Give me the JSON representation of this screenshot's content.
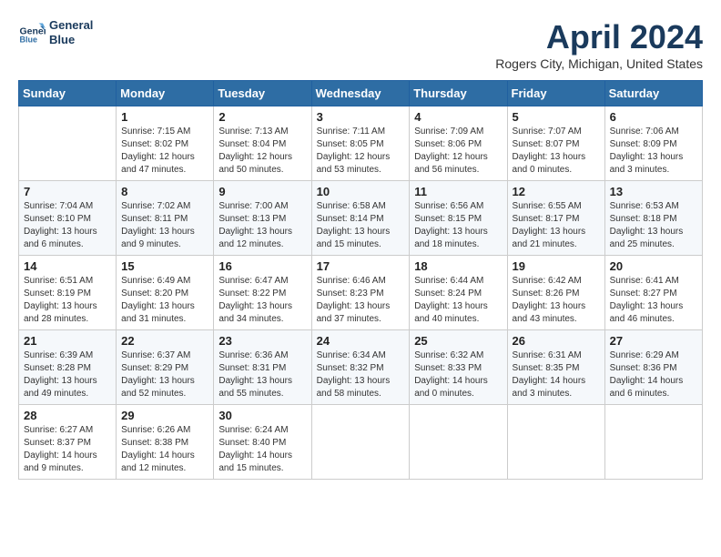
{
  "header": {
    "logo_line1": "General",
    "logo_line2": "Blue",
    "month_title": "April 2024",
    "location": "Rogers City, Michigan, United States"
  },
  "weekdays": [
    "Sunday",
    "Monday",
    "Tuesday",
    "Wednesday",
    "Thursday",
    "Friday",
    "Saturday"
  ],
  "weeks": [
    [
      {
        "day": "",
        "sunrise": "",
        "sunset": "",
        "daylight": ""
      },
      {
        "day": "1",
        "sunrise": "Sunrise: 7:15 AM",
        "sunset": "Sunset: 8:02 PM",
        "daylight": "Daylight: 12 hours and 47 minutes."
      },
      {
        "day": "2",
        "sunrise": "Sunrise: 7:13 AM",
        "sunset": "Sunset: 8:04 PM",
        "daylight": "Daylight: 12 hours and 50 minutes."
      },
      {
        "day": "3",
        "sunrise": "Sunrise: 7:11 AM",
        "sunset": "Sunset: 8:05 PM",
        "daylight": "Daylight: 12 hours and 53 minutes."
      },
      {
        "day": "4",
        "sunrise": "Sunrise: 7:09 AM",
        "sunset": "Sunset: 8:06 PM",
        "daylight": "Daylight: 12 hours and 56 minutes."
      },
      {
        "day": "5",
        "sunrise": "Sunrise: 7:07 AM",
        "sunset": "Sunset: 8:07 PM",
        "daylight": "Daylight: 13 hours and 0 minutes."
      },
      {
        "day": "6",
        "sunrise": "Sunrise: 7:06 AM",
        "sunset": "Sunset: 8:09 PM",
        "daylight": "Daylight: 13 hours and 3 minutes."
      }
    ],
    [
      {
        "day": "7",
        "sunrise": "Sunrise: 7:04 AM",
        "sunset": "Sunset: 8:10 PM",
        "daylight": "Daylight: 13 hours and 6 minutes."
      },
      {
        "day": "8",
        "sunrise": "Sunrise: 7:02 AM",
        "sunset": "Sunset: 8:11 PM",
        "daylight": "Daylight: 13 hours and 9 minutes."
      },
      {
        "day": "9",
        "sunrise": "Sunrise: 7:00 AM",
        "sunset": "Sunset: 8:13 PM",
        "daylight": "Daylight: 13 hours and 12 minutes."
      },
      {
        "day": "10",
        "sunrise": "Sunrise: 6:58 AM",
        "sunset": "Sunset: 8:14 PM",
        "daylight": "Daylight: 13 hours and 15 minutes."
      },
      {
        "day": "11",
        "sunrise": "Sunrise: 6:56 AM",
        "sunset": "Sunset: 8:15 PM",
        "daylight": "Daylight: 13 hours and 18 minutes."
      },
      {
        "day": "12",
        "sunrise": "Sunrise: 6:55 AM",
        "sunset": "Sunset: 8:17 PM",
        "daylight": "Daylight: 13 hours and 21 minutes."
      },
      {
        "day": "13",
        "sunrise": "Sunrise: 6:53 AM",
        "sunset": "Sunset: 8:18 PM",
        "daylight": "Daylight: 13 hours and 25 minutes."
      }
    ],
    [
      {
        "day": "14",
        "sunrise": "Sunrise: 6:51 AM",
        "sunset": "Sunset: 8:19 PM",
        "daylight": "Daylight: 13 hours and 28 minutes."
      },
      {
        "day": "15",
        "sunrise": "Sunrise: 6:49 AM",
        "sunset": "Sunset: 8:20 PM",
        "daylight": "Daylight: 13 hours and 31 minutes."
      },
      {
        "day": "16",
        "sunrise": "Sunrise: 6:47 AM",
        "sunset": "Sunset: 8:22 PM",
        "daylight": "Daylight: 13 hours and 34 minutes."
      },
      {
        "day": "17",
        "sunrise": "Sunrise: 6:46 AM",
        "sunset": "Sunset: 8:23 PM",
        "daylight": "Daylight: 13 hours and 37 minutes."
      },
      {
        "day": "18",
        "sunrise": "Sunrise: 6:44 AM",
        "sunset": "Sunset: 8:24 PM",
        "daylight": "Daylight: 13 hours and 40 minutes."
      },
      {
        "day": "19",
        "sunrise": "Sunrise: 6:42 AM",
        "sunset": "Sunset: 8:26 PM",
        "daylight": "Daylight: 13 hours and 43 minutes."
      },
      {
        "day": "20",
        "sunrise": "Sunrise: 6:41 AM",
        "sunset": "Sunset: 8:27 PM",
        "daylight": "Daylight: 13 hours and 46 minutes."
      }
    ],
    [
      {
        "day": "21",
        "sunrise": "Sunrise: 6:39 AM",
        "sunset": "Sunset: 8:28 PM",
        "daylight": "Daylight: 13 hours and 49 minutes."
      },
      {
        "day": "22",
        "sunrise": "Sunrise: 6:37 AM",
        "sunset": "Sunset: 8:29 PM",
        "daylight": "Daylight: 13 hours and 52 minutes."
      },
      {
        "day": "23",
        "sunrise": "Sunrise: 6:36 AM",
        "sunset": "Sunset: 8:31 PM",
        "daylight": "Daylight: 13 hours and 55 minutes."
      },
      {
        "day": "24",
        "sunrise": "Sunrise: 6:34 AM",
        "sunset": "Sunset: 8:32 PM",
        "daylight": "Daylight: 13 hours and 58 minutes."
      },
      {
        "day": "25",
        "sunrise": "Sunrise: 6:32 AM",
        "sunset": "Sunset: 8:33 PM",
        "daylight": "Daylight: 14 hours and 0 minutes."
      },
      {
        "day": "26",
        "sunrise": "Sunrise: 6:31 AM",
        "sunset": "Sunset: 8:35 PM",
        "daylight": "Daylight: 14 hours and 3 minutes."
      },
      {
        "day": "27",
        "sunrise": "Sunrise: 6:29 AM",
        "sunset": "Sunset: 8:36 PM",
        "daylight": "Daylight: 14 hours and 6 minutes."
      }
    ],
    [
      {
        "day": "28",
        "sunrise": "Sunrise: 6:27 AM",
        "sunset": "Sunset: 8:37 PM",
        "daylight": "Daylight: 14 hours and 9 minutes."
      },
      {
        "day": "29",
        "sunrise": "Sunrise: 6:26 AM",
        "sunset": "Sunset: 8:38 PM",
        "daylight": "Daylight: 14 hours and 12 minutes."
      },
      {
        "day": "30",
        "sunrise": "Sunrise: 6:24 AM",
        "sunset": "Sunset: 8:40 PM",
        "daylight": "Daylight: 14 hours and 15 minutes."
      },
      {
        "day": "",
        "sunrise": "",
        "sunset": "",
        "daylight": ""
      },
      {
        "day": "",
        "sunrise": "",
        "sunset": "",
        "daylight": ""
      },
      {
        "day": "",
        "sunrise": "",
        "sunset": "",
        "daylight": ""
      },
      {
        "day": "",
        "sunrise": "",
        "sunset": "",
        "daylight": ""
      }
    ]
  ]
}
